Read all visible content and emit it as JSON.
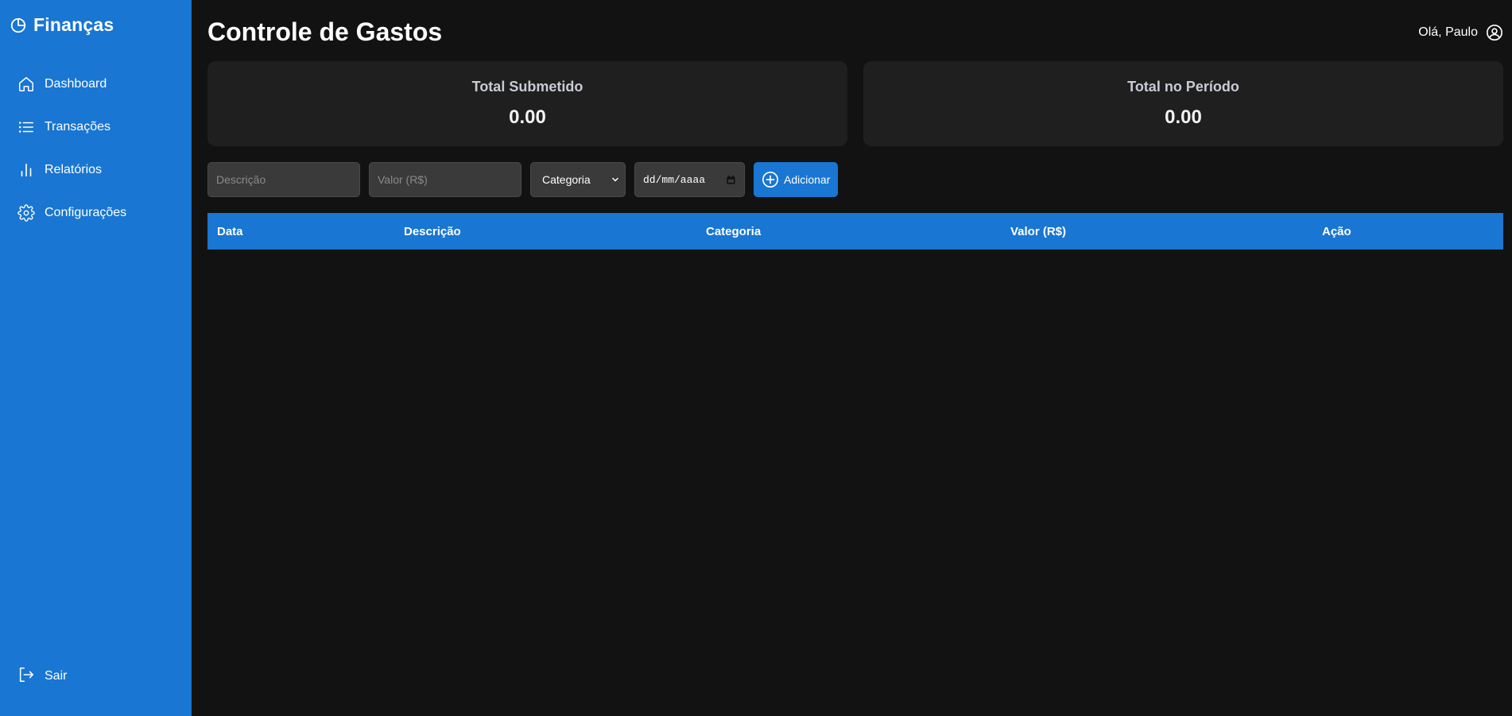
{
  "sidebar": {
    "brand": "Finanças",
    "items": [
      {
        "label": "Dashboard",
        "icon": "home-icon"
      },
      {
        "label": "Transações",
        "icon": "list-icon"
      },
      {
        "label": "Relatórios",
        "icon": "bar-chart-icon"
      },
      {
        "label": "Configurações",
        "icon": "gear-icon"
      }
    ],
    "logout_label": "Sair"
  },
  "header": {
    "title": "Controle de Gastos",
    "greeting": "Olá, Paulo"
  },
  "cards": [
    {
      "title": "Total Submetido",
      "value": "0.00"
    },
    {
      "title": "Total no Período",
      "value": "0.00"
    }
  ],
  "form": {
    "descricao_placeholder": "Descrição",
    "valor_placeholder": "Valor (R$)",
    "categoria_selected": "Categoria",
    "date_placeholder": "dd/mm/aaaa",
    "add_label": "Adicionar"
  },
  "table": {
    "columns": [
      "Data",
      "Descrição",
      "Categoria",
      "Valor (R$)",
      "Ação"
    ],
    "rows": []
  },
  "colors": {
    "accent": "#1976d2",
    "background": "#121212",
    "card": "#1f1f1f"
  }
}
